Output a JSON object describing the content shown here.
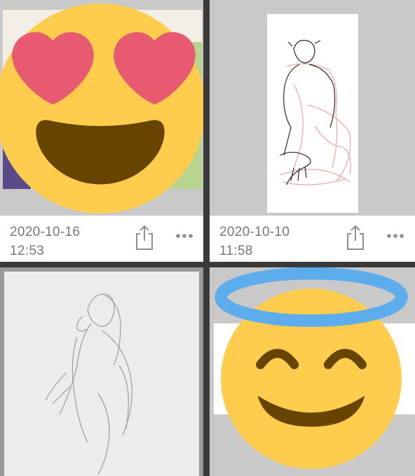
{
  "gallery": {
    "items": [
      {
        "date": "2020-10-16",
        "time": "12:53",
        "thumbnail": "colored-artwork-covered-by-heart-eyes-emoji",
        "share_icon": "share-icon",
        "more_icon": "ellipsis-icon"
      },
      {
        "date": "2020-10-10",
        "time": "11:58",
        "thumbnail": "pink-and-black-line-sketch",
        "share_icon": "share-icon",
        "more_icon": "ellipsis-icon"
      },
      {
        "thumbnail": "pencil-sketch-of-figure"
      },
      {
        "thumbnail": "smiling-face-with-halo-emoji"
      }
    ]
  },
  "colors": {
    "background": "#3a3a3a",
    "thumb_bg": "#c9c9c9",
    "emoji_yellow": "#FFCC4D",
    "heart_pink": "#E75A70",
    "mouth_brown": "#664500",
    "halo_blue": "#5DADEC",
    "meta_text": "#777777",
    "icon_gray": "#8e8e93"
  }
}
